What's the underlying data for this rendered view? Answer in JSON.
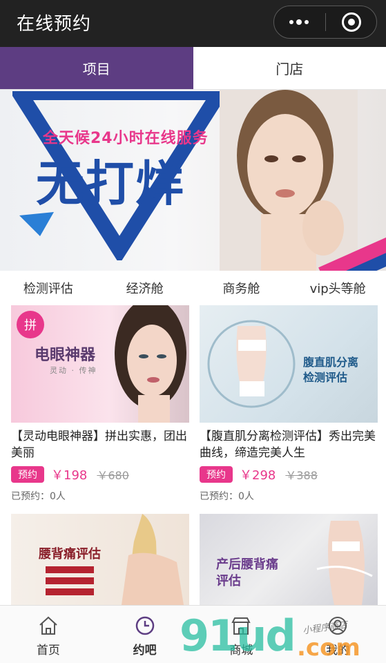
{
  "header": {
    "title": "在线预约"
  },
  "tabs": [
    {
      "label": "项目",
      "active": true
    },
    {
      "label": "门店",
      "active": false
    }
  ],
  "banner": {
    "tagline": "全天候24小时在线服务",
    "headline": "无打烊"
  },
  "categories": [
    "检测评估",
    "经济舱",
    "商务舱",
    "vip头等舱"
  ],
  "products": [
    {
      "group_badge": "拼",
      "image_title": "电眼神器",
      "image_subtitle": "灵动 · 传神",
      "name": "【灵动电眼神器】拼出实惠，团出美丽",
      "badge": "预约",
      "price": "￥198",
      "original_price": "￥680",
      "booked": "已预约：0人"
    },
    {
      "image_title": "腹直肌分离\n检测评估",
      "name": "【腹直肌分离检测评估】秀出完美曲线，缔造完美人生",
      "badge": "预约",
      "price": "￥298",
      "original_price": "￥388",
      "booked": "已预约：0人"
    },
    {
      "image_title": "腰背痛评估"
    },
    {
      "image_title": "产后腰背痛\n评估"
    }
  ],
  "tabbar": [
    {
      "label": "首页",
      "icon": "home-icon",
      "active": false
    },
    {
      "label": "约吧",
      "icon": "clock-icon",
      "active": true
    },
    {
      "label": "商城",
      "icon": "store-icon",
      "active": false
    },
    {
      "label": "我的",
      "icon": "user-icon",
      "active": false
    }
  ],
  "watermark": {
    "text": "91ud",
    "suffix": ".com",
    "note": "小程序商店"
  },
  "colors": {
    "accent": "#5d3d82",
    "pink": "#e8378b",
    "blue": "#1f4ea8",
    "titlebar": "#222222"
  }
}
